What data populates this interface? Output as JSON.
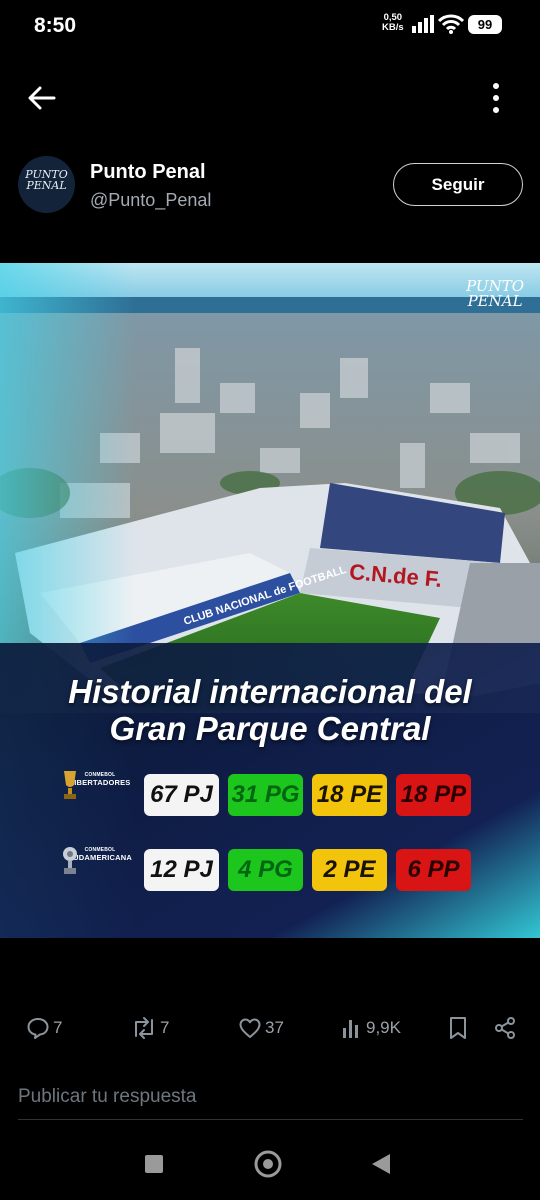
{
  "status": {
    "time": "8:50",
    "net_speed": "0,50",
    "net_unit": "KB/s",
    "battery": "99"
  },
  "nav": {
    "back_icon": "arrow-left-icon",
    "more_icon": "more-vertical-icon"
  },
  "profile": {
    "avatar_text_line1": "PUNTO",
    "avatar_text_line2": "PENAL",
    "name": "Punto Penal",
    "handle": "@Punto_Penal",
    "follow_label": "Seguir"
  },
  "media": {
    "brand_line1": "PUNTO",
    "brand_line2": "PENAL",
    "headline_line1": "Historial internacional del",
    "headline_line2": "Gran Parque Central",
    "rows": [
      {
        "comp_small": "CONMEBOL",
        "comp_name": "LIBERTADORES",
        "pj": "67 PJ",
        "pg": "31 PG",
        "pe": "18 PE",
        "pp": "18 PP"
      },
      {
        "comp_small": "CONMEBOL",
        "comp_name": "SUDAMERICANA",
        "pj": "12 PJ",
        "pg": "4 PG",
        "pe": "2 PE",
        "pp": "6 PP"
      }
    ]
  },
  "actions": {
    "replies": "7",
    "reposts": "7",
    "likes": "37",
    "views": "9,9K"
  },
  "reply": {
    "placeholder": "Publicar tu respuesta"
  }
}
